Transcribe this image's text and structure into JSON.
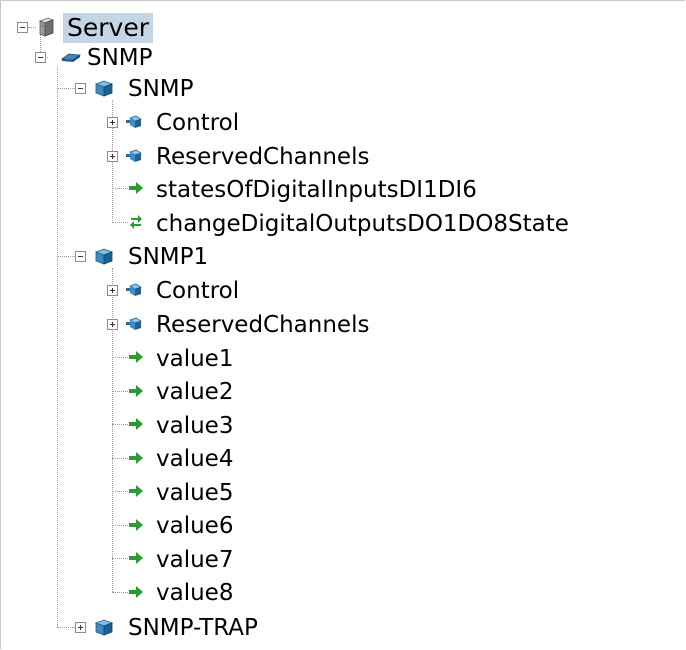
{
  "tree": {
    "server": {
      "label": "Server",
      "icon": "server-icon",
      "state": "expanded",
      "selected": true
    },
    "snmp_group": {
      "label": "SNMP",
      "icon": "snmp-device-icon",
      "state": "expanded"
    },
    "devices": [
      {
        "label": "SNMP",
        "icon": "device-cube-icon",
        "state": "expanded",
        "children": [
          {
            "label": "Control",
            "icon": "folder-node-icon",
            "state": "collapsed"
          },
          {
            "label": "ReservedChannels",
            "icon": "folder-node-icon",
            "state": "collapsed"
          },
          {
            "label": "statesOfDigitalInputsDI1DI6",
            "icon": "green-arrow-icon"
          },
          {
            "label": "changeDigitalOutputsDO1DO8State",
            "icon": "bidirectional-arrow-icon"
          }
        ]
      },
      {
        "label": "SNMP1",
        "icon": "device-cube-icon",
        "state": "expanded",
        "children": [
          {
            "label": "Control",
            "icon": "folder-node-icon",
            "state": "collapsed"
          },
          {
            "label": "ReservedChannels",
            "icon": "folder-node-icon",
            "state": "collapsed"
          },
          {
            "label": "value1",
            "icon": "green-arrow-icon"
          },
          {
            "label": "value2",
            "icon": "green-arrow-icon"
          },
          {
            "label": "value3",
            "icon": "green-arrow-icon"
          },
          {
            "label": "value4",
            "icon": "green-arrow-icon"
          },
          {
            "label": "value5",
            "icon": "green-arrow-icon"
          },
          {
            "label": "value6",
            "icon": "green-arrow-icon"
          },
          {
            "label": "value7",
            "icon": "green-arrow-icon"
          },
          {
            "label": "value8",
            "icon": "green-arrow-icon"
          }
        ]
      },
      {
        "label": "SNMP-TRAP",
        "icon": "device-cube-icon",
        "state": "collapsed"
      }
    ]
  },
  "colors": {
    "selection": "#c6d5e6",
    "connector": "#9a9a9a",
    "arrow_green": "#2e9a34",
    "node_blue": "#2a6f9c"
  }
}
